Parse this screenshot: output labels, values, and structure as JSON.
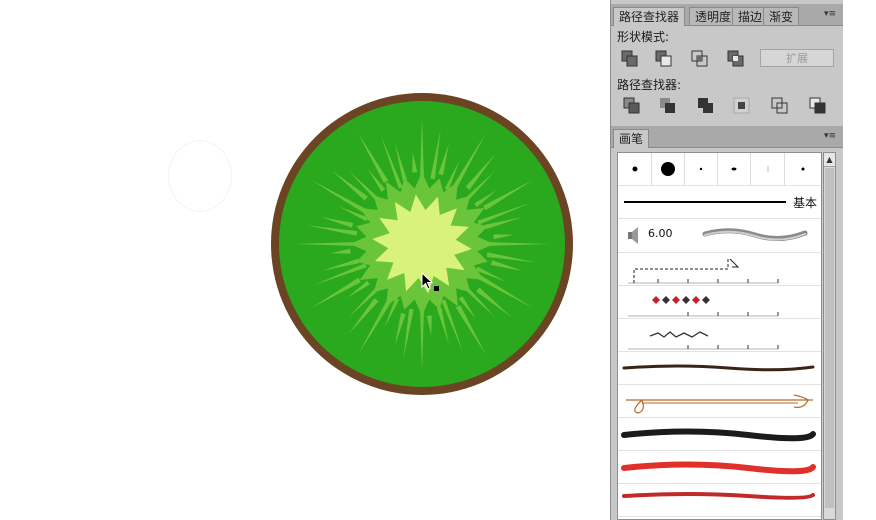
{
  "pathfinder_panel": {
    "tabs": [
      {
        "label": "路径查找器",
        "active": true
      },
      {
        "label": "透明度",
        "active": false
      },
      {
        "label": "描边",
        "active": false
      },
      {
        "label": "渐变",
        "active": false
      }
    ],
    "shape_modes_label": "形状模式:",
    "pathfinders_label": "路径查找器:",
    "expand_button": "扩展",
    "menu_glyph": "▾≡"
  },
  "brush_panel": {
    "tab_label": "画笔",
    "menu_glyph": "▾≡",
    "basic_brush_label": "基本",
    "scatter_value": "6.00"
  },
  "colors": {
    "kiwi_skin": "#6b4423",
    "kiwi_flesh": "#2aa81e",
    "kiwi_ring": "#6ac53a",
    "kiwi_core": "#d8f27a",
    "panel_bg": "#c8c8c8"
  }
}
